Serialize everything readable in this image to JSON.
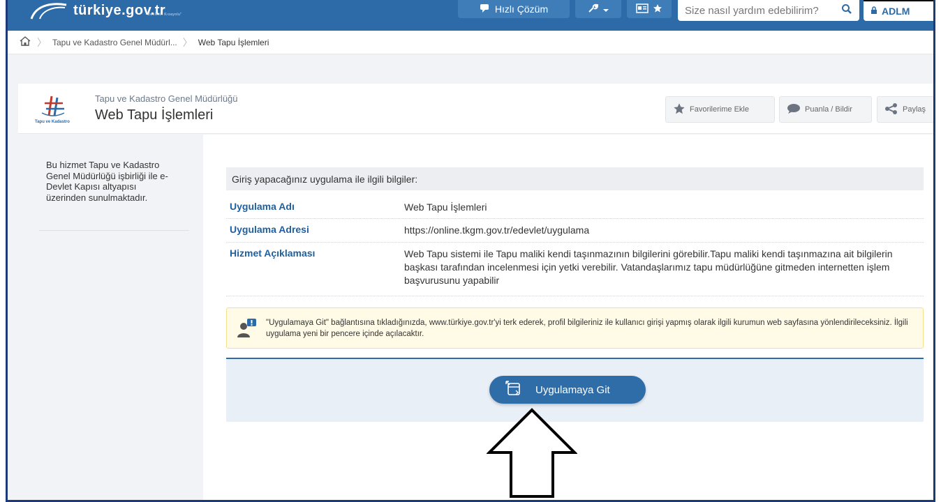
{
  "topbar": {
    "logo_text": "türkiye.gov.tr",
    "logo_sub": "\"Devletin Kısayolu\"",
    "quick_solution": "Hızlı Çözüm",
    "search_placeholder": "Size nasıl yardım edebilirim?",
    "login_label": "ADLM"
  },
  "breadcrumb": {
    "parent": "Tapu ve Kadastro Genel Müdürl...",
    "current": "Web Tapu İşlemleri"
  },
  "header": {
    "logo_caption": "Tapu ve Kadastro",
    "org_name": "Tapu ve Kadastro Genel Müdürlüğü",
    "service_title": "Web Tapu İşlemleri",
    "buttons": {
      "favorite": "Favorilerime Ekle",
      "rate": "Puanla / Bildir",
      "share": "Paylaş"
    }
  },
  "sidebar": {
    "text": "Bu hizmet Tapu ve Kadastro Genel Müdürlüğü işbirliği ile e-Devlet Kapısı altyapısı üzerinden sunulmaktadır."
  },
  "info": {
    "heading": "Giriş yapacağınız uygulama ile ilgili bilgiler:",
    "rows": [
      {
        "label": "Uygulama Adı",
        "value": "Web Tapu İşlemleri"
      },
      {
        "label": "Uygulama Adresi",
        "value": "https://online.tkgm.gov.tr/edevlet/uygulama"
      },
      {
        "label": "Hizmet Açıklaması",
        "value": "Web Tapu sistemi ile Tapu maliki kendi taşınmazının bilgilerini görebilir.Tapu maliki kendi taşınmazına ait bilgilerin başkası tarafından incelenmesi için yetki verebilir. Vatandaşlarımız tapu müdürlüğüne gitmeden internetten işlem başvurusunu yapabilir"
      }
    ]
  },
  "notice": {
    "text": "\"Uygulamaya Git\" bağlantısına tıkladığınızda, www.türkiye.gov.tr'yi terk ederek, profil bilgileriniz ile kullanıcı girişi yapmış olarak ilgili kurumun web sayfasına yönlendirileceksiniz. İlgili uygulama yeni bir pencere içinde açılacaktır."
  },
  "action": {
    "button_label": "Uygulamaya Git"
  },
  "colors": {
    "brand": "#2c6aa8",
    "label_blue": "#1f5f9e",
    "notice_bg": "#fffbe6"
  }
}
